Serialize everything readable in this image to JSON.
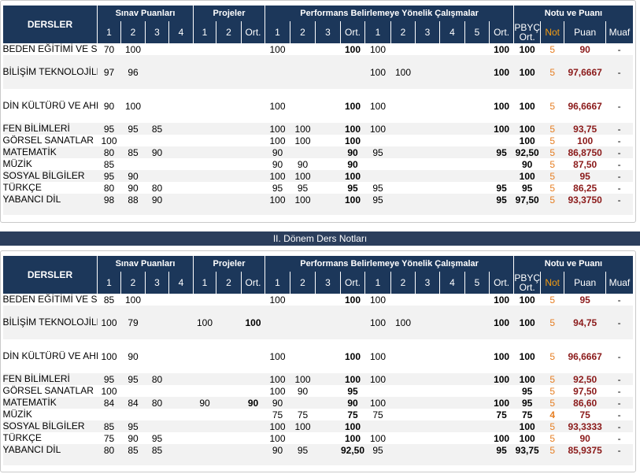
{
  "headers": {
    "dersler": "DERSLER",
    "sinav": "Sınav Puanları",
    "projeler": "Projeler",
    "performans": "Performans Belirlemeye Yönelik Çalışmalar",
    "notu": "Notu ve Puanı",
    "sinav_nums": [
      "1",
      "2",
      "3",
      "4"
    ],
    "proje_nums": [
      "1",
      "2",
      "Ort."
    ],
    "perf1_nums": [
      "1",
      "2",
      "3",
      "Ort."
    ],
    "perf2_nums": [
      "1",
      "2",
      "3",
      "4",
      "5",
      "Ort."
    ],
    "pbyc": "PBYÇ Ort.",
    "not": "Not",
    "puan": "Puan",
    "muaf": "Muaf"
  },
  "term2_title": "II. Dönem Ders Notları",
  "term1_rows": [
    {
      "name": "BEDEN EĞİTİMİ VE SPOR",
      "s1": "70",
      "s2": "100",
      "s3": "",
      "s4": "",
      "p1": "",
      "p2": "",
      "port": "",
      "a1": "100",
      "a2": "",
      "a3": "",
      "aort": "100",
      "b1": "100",
      "b2": "",
      "b3": "",
      "b4": "",
      "b5": "",
      "bort": "100",
      "pbyc": "100",
      "not": "5",
      "puan": "90",
      "muaf": "-"
    },
    {
      "name": "BİLİŞİM TEKNOLOJİLERİ VE YAZILIM",
      "s1": "97",
      "s2": "96",
      "s3": "",
      "s4": "",
      "p1": "",
      "p2": "",
      "port": "",
      "a1": "",
      "a2": "",
      "a3": "",
      "aort": "",
      "b1": "100",
      "b2": "100",
      "b3": "",
      "b4": "",
      "b5": "",
      "bort": "100",
      "pbyc": "100",
      "not": "5",
      "puan": "97,6667",
      "muaf": "-"
    },
    {
      "name": "DİN KÜLTÜRÜ VE AHLAK BİLGİSİ",
      "s1": "90",
      "s2": "100",
      "s3": "",
      "s4": "",
      "p1": "",
      "p2": "",
      "port": "",
      "a1": "100",
      "a2": "",
      "a3": "",
      "aort": "100",
      "b1": "100",
      "b2": "",
      "b3": "",
      "b4": "",
      "b5": "",
      "bort": "100",
      "pbyc": "100",
      "not": "5",
      "puan": "96,6667",
      "muaf": "-"
    },
    {
      "name": "FEN BİLİMLERİ",
      "s1": "95",
      "s2": "95",
      "s3": "85",
      "s4": "",
      "p1": "",
      "p2": "",
      "port": "",
      "a1": "100",
      "a2": "100",
      "a3": "",
      "aort": "100",
      "b1": "100",
      "b2": "",
      "b3": "",
      "b4": "",
      "b5": "",
      "bort": "100",
      "pbyc": "100",
      "not": "5",
      "puan": "93,75",
      "muaf": "-"
    },
    {
      "name": "GÖRSEL SANATLAR",
      "s1": "100",
      "s2": "",
      "s3": "",
      "s4": "",
      "p1": "",
      "p2": "",
      "port": "",
      "a1": "100",
      "a2": "100",
      "a3": "",
      "aort": "100",
      "b1": "",
      "b2": "",
      "b3": "",
      "b4": "",
      "b5": "",
      "bort": "",
      "pbyc": "100",
      "not": "5",
      "puan": "100",
      "muaf": "-"
    },
    {
      "name": "MATEMATİK",
      "s1": "80",
      "s2": "85",
      "s3": "90",
      "s4": "",
      "p1": "",
      "p2": "",
      "port": "",
      "a1": "90",
      "a2": "",
      "a3": "",
      "aort": "90",
      "b1": "95",
      "b2": "",
      "b3": "",
      "b4": "",
      "b5": "",
      "bort": "95",
      "pbyc": "92,50",
      "not": "5",
      "puan": "86,8750",
      "muaf": "-"
    },
    {
      "name": "MÜZİK",
      "s1": "85",
      "s2": "",
      "s3": "",
      "s4": "",
      "p1": "",
      "p2": "",
      "port": "",
      "a1": "90",
      "a2": "90",
      "a3": "",
      "aort": "90",
      "b1": "",
      "b2": "",
      "b3": "",
      "b4": "",
      "b5": "",
      "bort": "",
      "pbyc": "90",
      "not": "5",
      "puan": "87,50",
      "muaf": "-"
    },
    {
      "name": "SOSYAL BİLGİLER",
      "s1": "95",
      "s2": "90",
      "s3": "",
      "s4": "",
      "p1": "",
      "p2": "",
      "port": "",
      "a1": "100",
      "a2": "100",
      "a3": "",
      "aort": "100",
      "b1": "",
      "b2": "",
      "b3": "",
      "b4": "",
      "b5": "",
      "bort": "",
      "pbyc": "100",
      "not": "5",
      "puan": "95",
      "muaf": "-"
    },
    {
      "name": "TÜRKÇE",
      "s1": "80",
      "s2": "90",
      "s3": "80",
      "s4": "",
      "p1": "",
      "p2": "",
      "port": "",
      "a1": "95",
      "a2": "95",
      "a3": "",
      "aort": "95",
      "b1": "95",
      "b2": "",
      "b3": "",
      "b4": "",
      "b5": "",
      "bort": "95",
      "pbyc": "95",
      "not": "5",
      "puan": "86,25",
      "muaf": "-"
    },
    {
      "name": "YABANCI DİL",
      "s1": "98",
      "s2": "88",
      "s3": "90",
      "s4": "",
      "p1": "",
      "p2": "",
      "port": "",
      "a1": "100",
      "a2": "100",
      "a3": "",
      "aort": "100",
      "b1": "95",
      "b2": "",
      "b3": "",
      "b4": "",
      "b5": "",
      "bort": "95",
      "pbyc": "97,50",
      "not": "5",
      "puan": "93,3750",
      "muaf": "-"
    }
  ],
  "term2_rows": [
    {
      "name": "BEDEN EĞİTİMİ VE SPOR",
      "s1": "85",
      "s2": "100",
      "s3": "",
      "s4": "",
      "p1": "",
      "p2": "",
      "port": "",
      "a1": "100",
      "a2": "",
      "a3": "",
      "aort": "100",
      "b1": "100",
      "b2": "",
      "b3": "",
      "b4": "",
      "b5": "",
      "bort": "100",
      "pbyc": "100",
      "not": "5",
      "puan": "95",
      "muaf": "-"
    },
    {
      "name": "BİLİŞİM TEKNOLOJİLERİ VE YAZILIM",
      "s1": "100",
      "s2": "79",
      "s3": "",
      "s4": "",
      "p1": "100",
      "p2": "",
      "port": "100",
      "a1": "",
      "a2": "",
      "a3": "",
      "aort": "",
      "b1": "100",
      "b2": "100",
      "b3": "",
      "b4": "",
      "b5": "",
      "bort": "100",
      "pbyc": "100",
      "not": "5",
      "puan": "94,75",
      "muaf": "-"
    },
    {
      "name": "DİN KÜLTÜRÜ VE AHLAK BİLGİSİ",
      "s1": "100",
      "s2": "90",
      "s3": "",
      "s4": "",
      "p1": "",
      "p2": "",
      "port": "",
      "a1": "100",
      "a2": "",
      "a3": "",
      "aort": "100",
      "b1": "100",
      "b2": "",
      "b3": "",
      "b4": "",
      "b5": "",
      "bort": "100",
      "pbyc": "100",
      "not": "5",
      "puan": "96,6667",
      "muaf": "-"
    },
    {
      "name": "FEN BİLİMLERİ",
      "s1": "95",
      "s2": "95",
      "s3": "80",
      "s4": "",
      "p1": "",
      "p2": "",
      "port": "",
      "a1": "100",
      "a2": "100",
      "a3": "",
      "aort": "100",
      "b1": "100",
      "b2": "",
      "b3": "",
      "b4": "",
      "b5": "",
      "bort": "100",
      "pbyc": "100",
      "not": "5",
      "puan": "92,50",
      "muaf": "-"
    },
    {
      "name": "GÖRSEL SANATLAR",
      "s1": "100",
      "s2": "",
      "s3": "",
      "s4": "",
      "p1": "",
      "p2": "",
      "port": "",
      "a1": "100",
      "a2": "90",
      "a3": "",
      "aort": "95",
      "b1": "",
      "b2": "",
      "b3": "",
      "b4": "",
      "b5": "",
      "bort": "",
      "pbyc": "95",
      "not": "5",
      "puan": "97,50",
      "muaf": "-"
    },
    {
      "name": "MATEMATİK",
      "s1": "84",
      "s2": "84",
      "s3": "80",
      "s4": "",
      "p1": "90",
      "p2": "",
      "port": "90",
      "a1": "90",
      "a2": "",
      "a3": "",
      "aort": "90",
      "b1": "100",
      "b2": "",
      "b3": "",
      "b4": "",
      "b5": "",
      "bort": "100",
      "pbyc": "95",
      "not": "5",
      "puan": "86,60",
      "muaf": "-"
    },
    {
      "name": "MÜZİK",
      "s1": "",
      "s2": "",
      "s3": "",
      "s4": "",
      "p1": "",
      "p2": "",
      "port": "",
      "a1": "75",
      "a2": "75",
      "a3": "",
      "aort": "75",
      "b1": "75",
      "b2": "",
      "b3": "",
      "b4": "",
      "b5": "",
      "bort": "75",
      "pbyc": "75",
      "not": "4",
      "puan": "75",
      "muaf": "-"
    },
    {
      "name": "SOSYAL BİLGİLER",
      "s1": "85",
      "s2": "95",
      "s3": "",
      "s4": "",
      "p1": "",
      "p2": "",
      "port": "",
      "a1": "100",
      "a2": "100",
      "a3": "",
      "aort": "100",
      "b1": "",
      "b2": "",
      "b3": "",
      "b4": "",
      "b5": "",
      "bort": "",
      "pbyc": "100",
      "not": "5",
      "puan": "93,3333",
      "muaf": "-"
    },
    {
      "name": "TÜRKÇE",
      "s1": "75",
      "s2": "90",
      "s3": "95",
      "s4": "",
      "p1": "",
      "p2": "",
      "port": "",
      "a1": "100",
      "a2": "",
      "a3": "",
      "aort": "100",
      "b1": "100",
      "b2": "",
      "b3": "",
      "b4": "",
      "b5": "",
      "bort": "100",
      "pbyc": "100",
      "not": "5",
      "puan": "90",
      "muaf": "-"
    },
    {
      "name": "YABANCI DİL",
      "s1": "80",
      "s2": "85",
      "s3": "85",
      "s4": "",
      "p1": "",
      "p2": "",
      "port": "",
      "a1": "90",
      "a2": "95",
      "a3": "",
      "aort": "92,50",
      "b1": "95",
      "b2": "",
      "b3": "",
      "b4": "",
      "b5": "",
      "bort": "95",
      "pbyc": "93,75",
      "not": "5",
      "puan": "85,9375",
      "muaf": "-"
    }
  ]
}
